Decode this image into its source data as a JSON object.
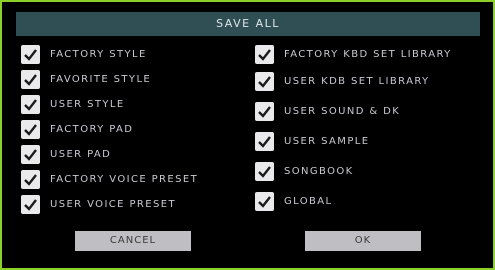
{
  "dialog": {
    "title": "SAVE ALL",
    "left_options": [
      {
        "label": "FACTORY STYLE",
        "checked": true
      },
      {
        "label": "FAVORITE STYLE",
        "checked": true
      },
      {
        "label": "USER STYLE",
        "checked": true
      },
      {
        "label": "FACTORY PAD",
        "checked": true
      },
      {
        "label": "USER PAD",
        "checked": true
      },
      {
        "label": "FACTORY VOICE PRESET",
        "checked": true
      },
      {
        "label": "USER VOICE PRESET",
        "checked": true
      }
    ],
    "right_options": [
      {
        "label": "FACTORY KBD SET LIBRARY",
        "checked": true
      },
      {
        "label": "USER KDB SET LIBRARY",
        "checked": true
      },
      {
        "label": "USER SOUND & DK",
        "checked": true
      },
      {
        "label": "USER SAMPLE",
        "checked": true
      },
      {
        "label": "SONGBOOK",
        "checked": true
      },
      {
        "label": "GLOBAL",
        "checked": true
      }
    ],
    "cancel_label": "CANCEL",
    "ok_label": "OK"
  },
  "colors": {
    "frame": "#8bd12a",
    "title_bar": "#2f4f55",
    "checkbox": "#e9e9ec",
    "checkmark": "#1a1a1a",
    "button": "#bfbfc3"
  }
}
